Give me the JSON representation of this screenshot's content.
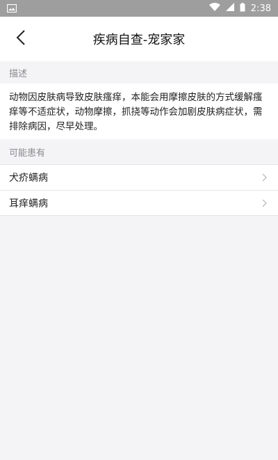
{
  "status_bar": {
    "time": "2:38",
    "icons": [
      "gallery-icon",
      "wifi-icon",
      "signal-icon",
      "battery-icon"
    ]
  },
  "header": {
    "title": "疾病自查-宠家家",
    "back_icon": "chevron-left-icon"
  },
  "description": {
    "section_label": "描述",
    "text": "动物因皮肤病导致皮肤瘙痒，本能会用摩擦皮肤的方式缓解瘙痒等不适症状，动物摩擦，抓挠等动作会加剧皮肤病症状，需排除病因，尽早处理。"
  },
  "possible": {
    "section_label": "可能患有",
    "items": [
      {
        "label": "犬疥螨病"
      },
      {
        "label": "耳痒螨病"
      }
    ]
  },
  "colors": {
    "status_bar": "#9e9e9e",
    "background": "#f4f4f6",
    "card": "#ffffff",
    "section_text": "#8a8a8f"
  }
}
